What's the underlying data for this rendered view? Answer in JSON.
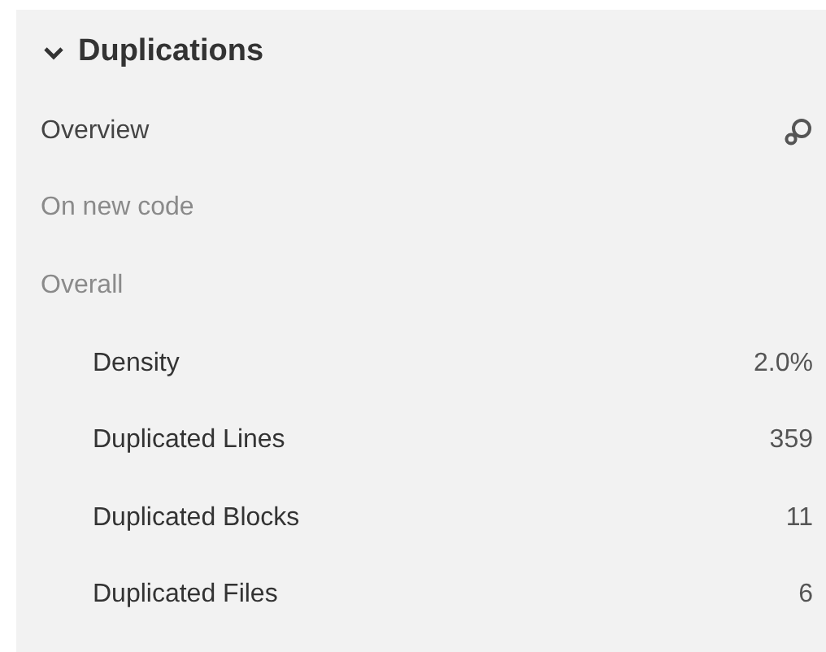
{
  "section": {
    "title": "Duplications",
    "expanded": true
  },
  "items": [
    {
      "kind": "link",
      "label": "Overview"
    },
    {
      "kind": "heading",
      "label": "On new code"
    },
    {
      "kind": "heading",
      "label": "Overall"
    },
    {
      "kind": "metric",
      "label": "Density",
      "value": "2.0%"
    },
    {
      "kind": "metric",
      "label": "Duplicated Lines",
      "value": "359"
    },
    {
      "kind": "metric",
      "label": "Duplicated Blocks",
      "value": "11"
    },
    {
      "kind": "metric",
      "label": "Duplicated Files",
      "value": "6"
    }
  ]
}
